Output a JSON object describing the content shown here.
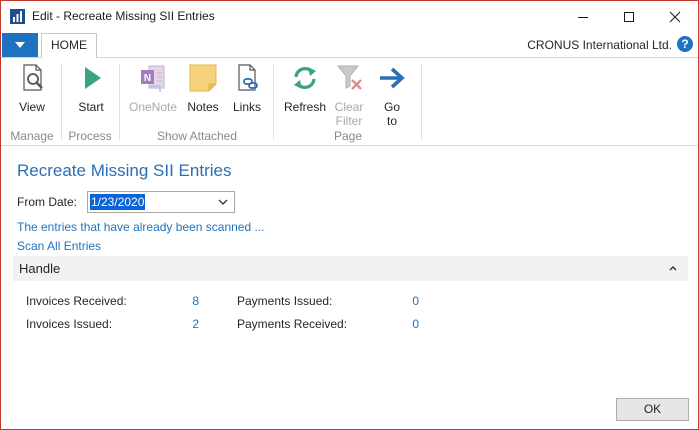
{
  "window": {
    "title": "Edit - Recreate Missing SII Entries",
    "accent_color": "#c0392b"
  },
  "tabs": {
    "home_label": "HOME"
  },
  "header": {
    "company": "CRONUS International Ltd."
  },
  "ribbon": {
    "view_label": "View",
    "start_label": "Start",
    "onenote_label": "OneNote",
    "notes_label": "Notes",
    "links_label": "Links",
    "refresh_label": "Refresh",
    "clear_filter_label_1": "Clear",
    "clear_filter_label_2": "Filter",
    "goto_label_1": "Go",
    "goto_label_2": "to",
    "groups": {
      "manage": "Manage",
      "process": "Process",
      "show_attached": "Show Attached",
      "page": "Page"
    }
  },
  "page": {
    "title": "Recreate Missing SII Entries",
    "from_date_label": "From Date:",
    "from_date_value": "1/23/2020",
    "scanned_link": "The entries that have already been scanned ...",
    "scan_all_link": "Scan All Entries"
  },
  "handle": {
    "title": "Handle",
    "invoices_received_label": "Invoices Received:",
    "invoices_received_value": "8",
    "invoices_issued_label": "Invoices Issued:",
    "invoices_issued_value": "2",
    "payments_issued_label": "Payments Issued:",
    "payments_issued_value": "0",
    "payments_received_label": "Payments Received:",
    "payments_received_value": "0"
  },
  "footer": {
    "ok_label": "OK"
  }
}
